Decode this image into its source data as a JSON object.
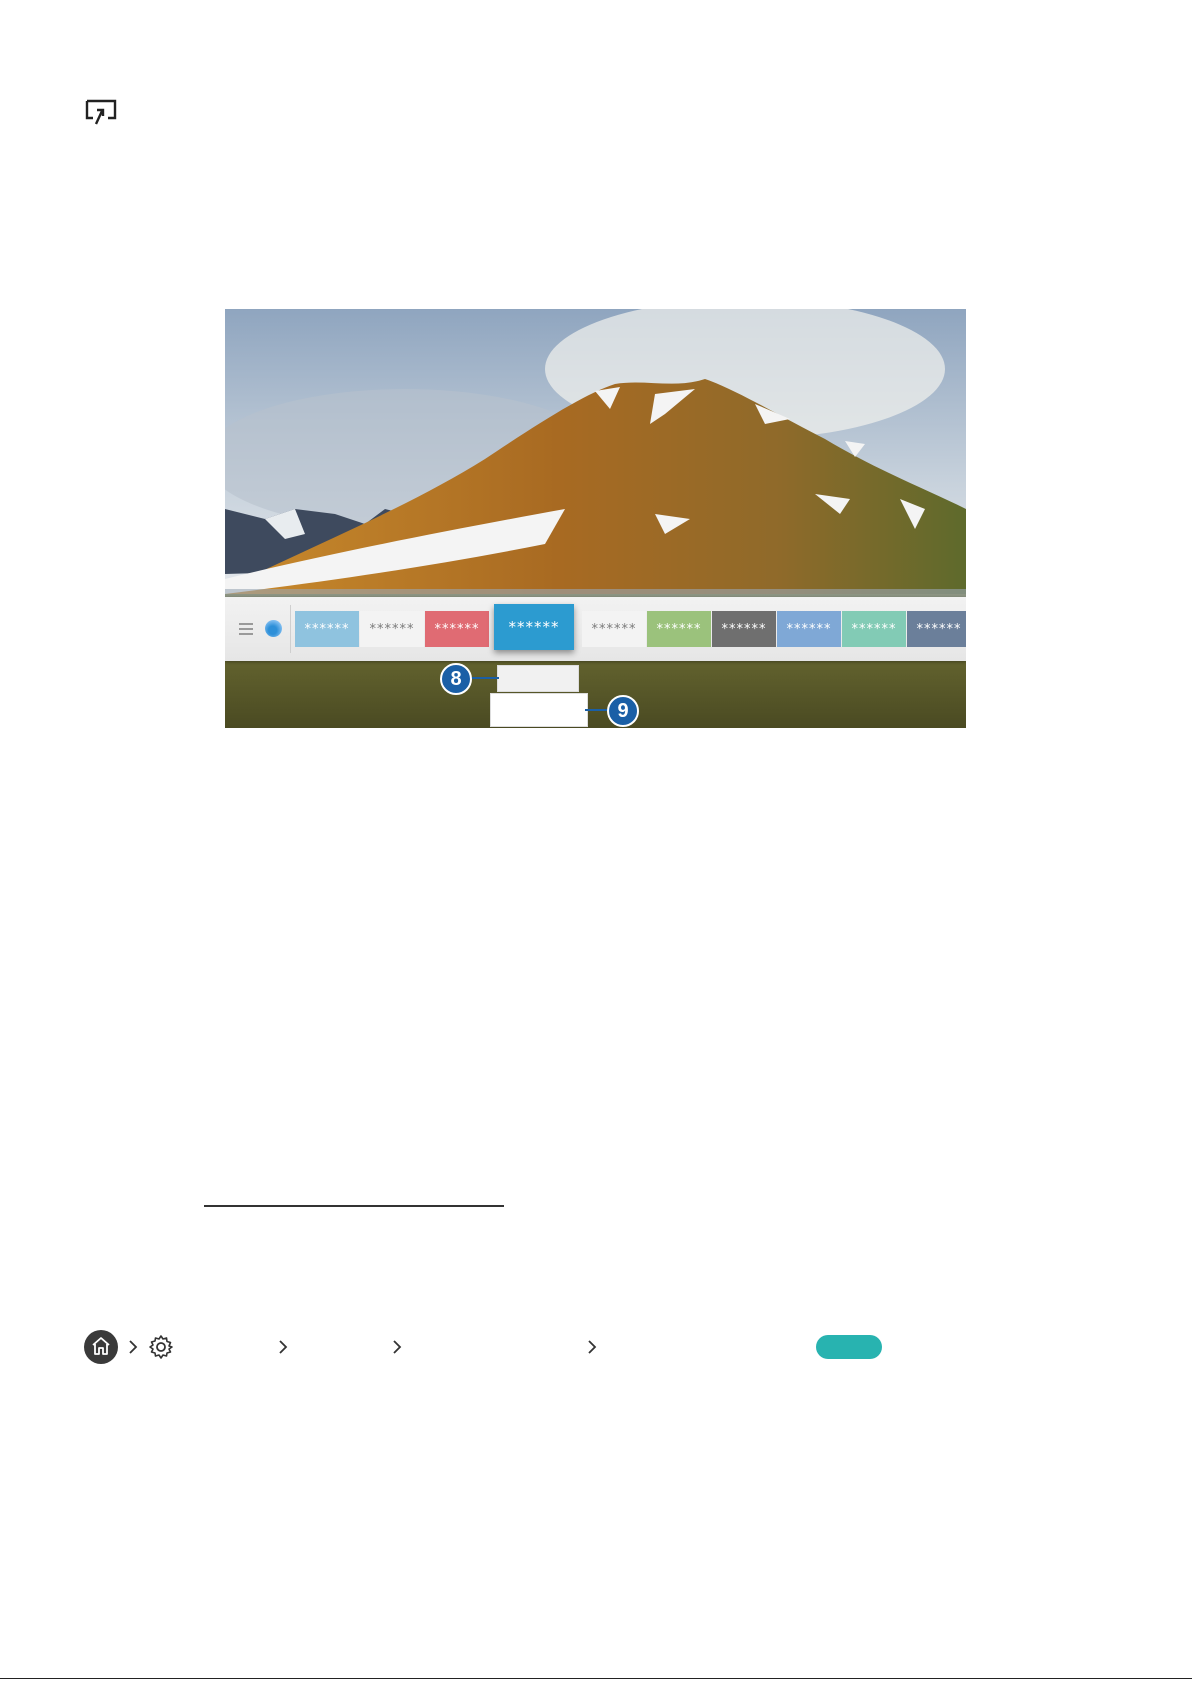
{
  "icons": {
    "screen_mirror": "screen-mirror-icon",
    "home": "home-icon",
    "settings": "gear-icon"
  },
  "tv_screen": {
    "tiles": [
      {
        "label": "******",
        "color": "#8fc3df",
        "active": false
      },
      {
        "label": "******",
        "color": "#f3f3f3",
        "text_color": "#7a7a7a",
        "active": false
      },
      {
        "label": "******",
        "color": "#e06b73",
        "active": false
      },
      {
        "label": "******",
        "color": "#2c9bd0",
        "active": true
      },
      {
        "label": "******",
        "color": "#f3f3f3",
        "text_color": "#7a7a7a",
        "active": false
      },
      {
        "label": "******",
        "color": "#9bc27c",
        "active": false
      },
      {
        "label": "******",
        "color": "#6f6f6f",
        "active": false
      },
      {
        "label": "******",
        "color": "#7fa8d6",
        "active": false
      },
      {
        "label": "******",
        "color": "#82cbb5",
        "active": false
      },
      {
        "label": "******",
        "color": "#6b7f9a",
        "active": false
      }
    ],
    "callouts": [
      {
        "number": "8"
      },
      {
        "number": "9"
      }
    ],
    "callout_color": "#1a5fa6"
  },
  "breadcrumb": {
    "accent_color": "#28b3b0"
  }
}
